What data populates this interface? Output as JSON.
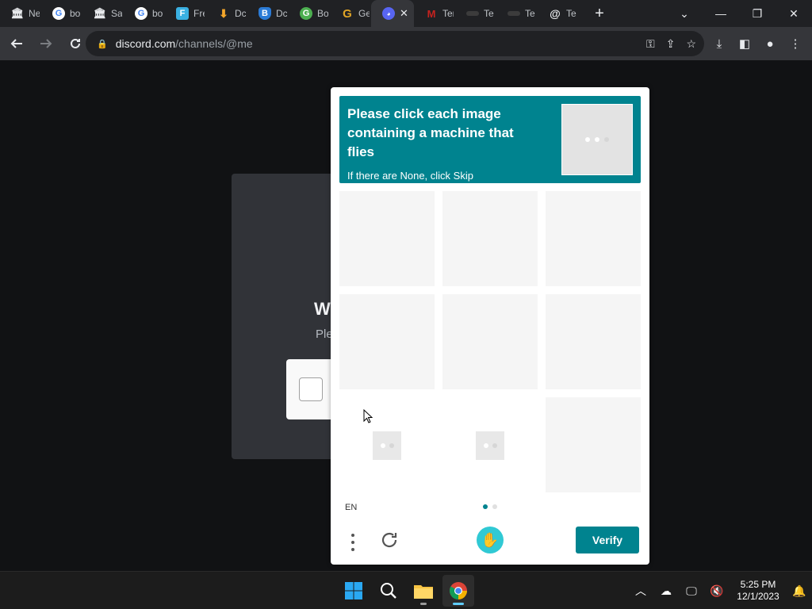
{
  "browser": {
    "tabs": [
      {
        "title": "Ne",
        "icon": "bank-icon",
        "color": "#202124"
      },
      {
        "title": "bo",
        "icon": "google-icon",
        "color": "#ffffff"
      },
      {
        "title": "Sa",
        "icon": "bank-icon",
        "color": "#202124"
      },
      {
        "title": "bo",
        "icon": "google-icon",
        "color": "#ffffff"
      },
      {
        "title": "Fre",
        "icon": "freepik-icon",
        "color": "#3ab0e2"
      },
      {
        "title": "Dc",
        "icon": "download-icon",
        "color": "#f4a62a"
      },
      {
        "title": "Dc",
        "icon": "b-shield-icon",
        "color": "#2b7bd6"
      },
      {
        "title": "Bo",
        "icon": "g-circle-icon",
        "color": "#4caf50"
      },
      {
        "title": "Ge",
        "icon": "g-letter-icon",
        "color": "#e0a526"
      },
      {
        "title": "",
        "icon": "discord-icon",
        "color": "#5865f2",
        "active": true
      },
      {
        "title": "Ter",
        "icon": "gmail-icon",
        "color": "#c5221f"
      },
      {
        "title": "Te",
        "icon": "blank-icon",
        "color": "#3c3c3c"
      },
      {
        "title": "Te",
        "icon": "blank-icon",
        "color": "#3c3c3c"
      },
      {
        "title": "Te",
        "icon": "at-icon",
        "color": "#202124"
      }
    ],
    "new_tab_glyph": "+",
    "url_host": "discord.com",
    "url_path": "/channels/@me"
  },
  "discord": {
    "heading": "W",
    "sub": "Ple"
  },
  "captcha": {
    "prompt_main": "Please click each image containing a machine that flies",
    "prompt_sub": "If there are None, click Skip",
    "language": "EN",
    "verify_label": "Verify",
    "accent_color": "#00838f",
    "pages_total": 2,
    "page_current": 1
  },
  "taskbar": {
    "time": "5:25 PM",
    "date": "12/1/2023"
  }
}
